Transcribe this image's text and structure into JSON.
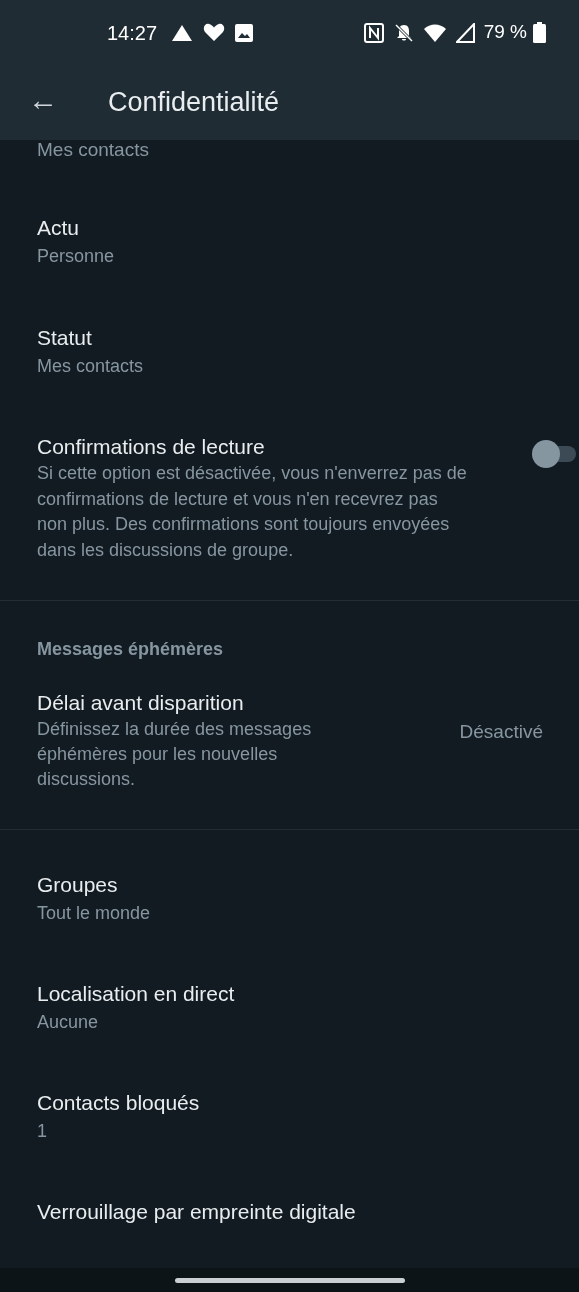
{
  "status_bar": {
    "time": "14:27",
    "battery": "79 %"
  },
  "app_bar": {
    "back_icon": "←",
    "title": "Confidentialité"
  },
  "top_subtitle": "Mes contacts",
  "items": [
    {
      "kind": "simple",
      "title": "Actu",
      "subtitle": "Personne"
    },
    {
      "kind": "simple",
      "title": "Statut",
      "subtitle": "Mes contacts"
    },
    {
      "kind": "toggle",
      "title": "Confirmations de lecture",
      "description": "Si cette option est désactivée, vous n'enverrez pas de confirmations de lecture et vous n'en recevrez pas non plus. Des confirmations sont toujours envoyées dans les discussions de groupe.",
      "checked": false
    }
  ],
  "section": {
    "header": "Messages éphémères",
    "items": [
      {
        "kind": "value",
        "title": "Délai avant disparition",
        "description": "Définissez la durée des messages éphémères pour les nouvelles discussions.",
        "value": "Désactivé"
      }
    ]
  },
  "more_items": [
    {
      "kind": "simple",
      "title": "Groupes",
      "subtitle": "Tout le monde"
    },
    {
      "kind": "simple",
      "title": "Localisation en direct",
      "subtitle": "Aucune"
    },
    {
      "kind": "simple",
      "title": "Contacts bloqués",
      "subtitle": "1"
    },
    {
      "kind": "simple",
      "title": "Verrouillage par empreinte digitale"
    }
  ]
}
